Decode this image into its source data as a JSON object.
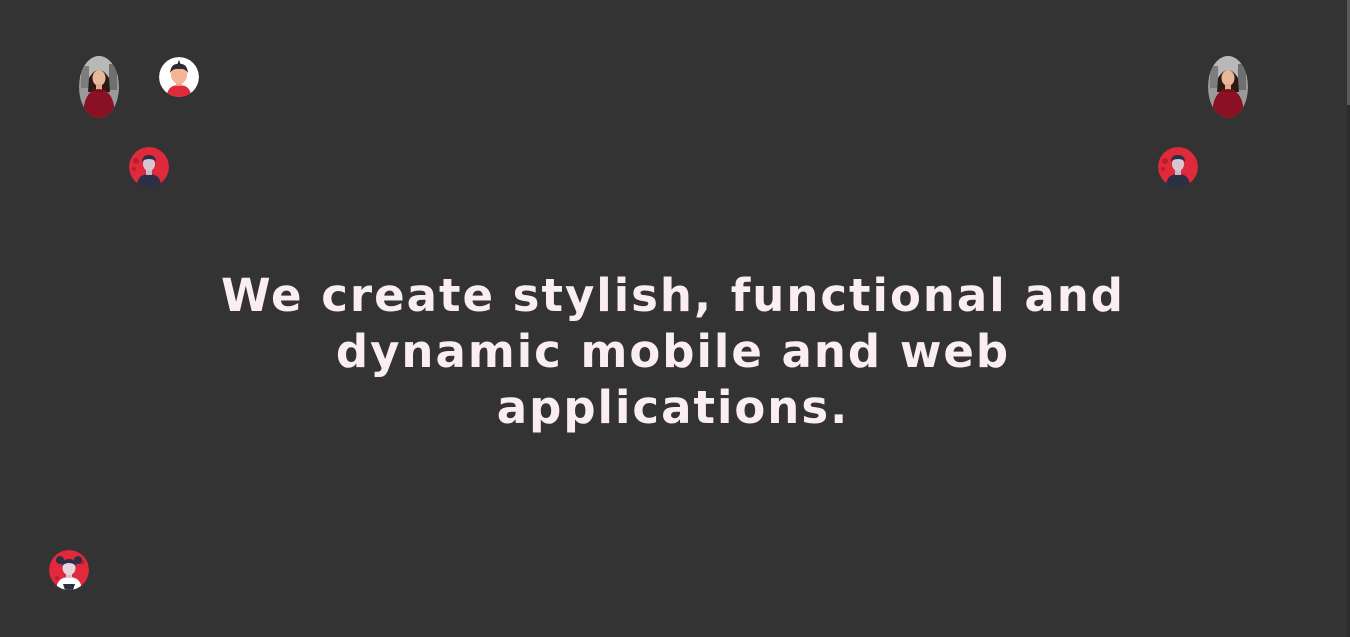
{
  "hero": {
    "headline": "We create stylish, functional and dynamic mobile and web applications."
  },
  "avatars": [
    {
      "name": "woman-photo-avatar",
      "icon": "woman-photo-icon"
    },
    {
      "name": "boy-avatar",
      "icon": "boy-icon"
    },
    {
      "name": "man-avatar",
      "icon": "man-icon"
    },
    {
      "name": "woman-photo-avatar",
      "icon": "woman-photo-icon"
    },
    {
      "name": "man-avatar",
      "icon": "man-icon"
    },
    {
      "name": "girl-avatar",
      "icon": "girl-icon"
    }
  ],
  "colors": {
    "background": "#333333",
    "headline_text": "#fbeef0",
    "accent_red": "#e0293b",
    "sweater_red": "#8a1024",
    "figure_dark": "#2b2f45"
  }
}
